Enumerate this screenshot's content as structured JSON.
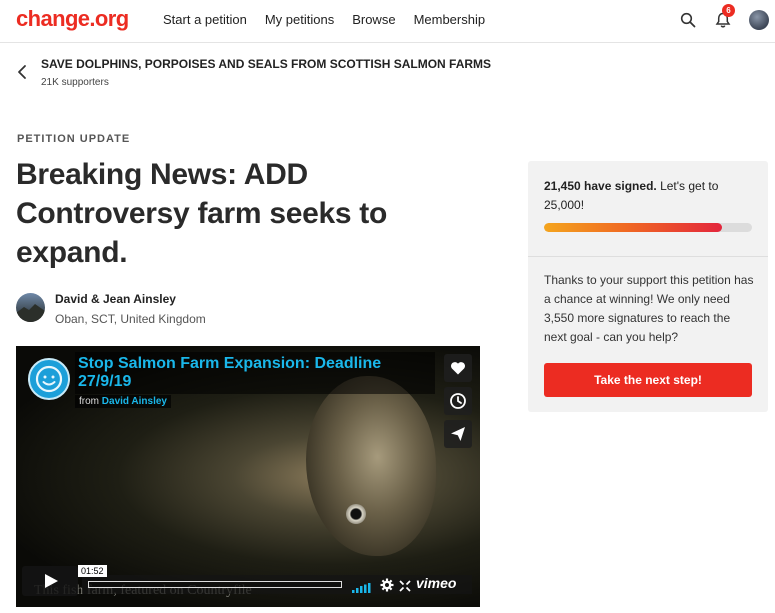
{
  "nav": {
    "logo": "change.org",
    "links": [
      "Start a petition",
      "My petitions",
      "Browse",
      "Membership"
    ],
    "notification_count": "6"
  },
  "petition": {
    "title": "SAVE DOLPHINS, PORPOISES AND SEALS FROM SCOTTISH SALMON FARMS",
    "supporters": "21K supporters"
  },
  "update": {
    "label": "PETITION UPDATE",
    "headline": "Breaking News: ADD Controversy farm seeks to expand.",
    "author_name": "David & Jean Ainsley",
    "author_location": "Oban, SCT, United Kingdom"
  },
  "video": {
    "title": "Stop Salmon Farm Expansion: Deadline 27/9/19",
    "from_prefix": "from",
    "from_name": "David Ainsley",
    "caption": "This fish farm, featured on Countryfile",
    "timestamp": "01:52",
    "brand": "vimeo",
    "progress": 0.0
  },
  "sidebar": {
    "signed_count": "21,450 have signed.",
    "signed_goal_text": " Let's get to 25,000!",
    "progress": 0.858,
    "support_text": "Thanks to your support this petition has a chance at winning! We only need 3,550 more signatures to reach the next goal - can you help?",
    "cta_label": "Take the next step!"
  },
  "colors": {
    "brand_red": "#ec2c22",
    "vimeo_blue": "#1ab7ea"
  },
  "icons": [
    "search-icon",
    "bell-icon",
    "back-chevron-icon",
    "heart-icon",
    "clock-icon",
    "send-icon",
    "play-icon",
    "volume-icon",
    "gear-icon",
    "fullscreen-icon"
  ]
}
